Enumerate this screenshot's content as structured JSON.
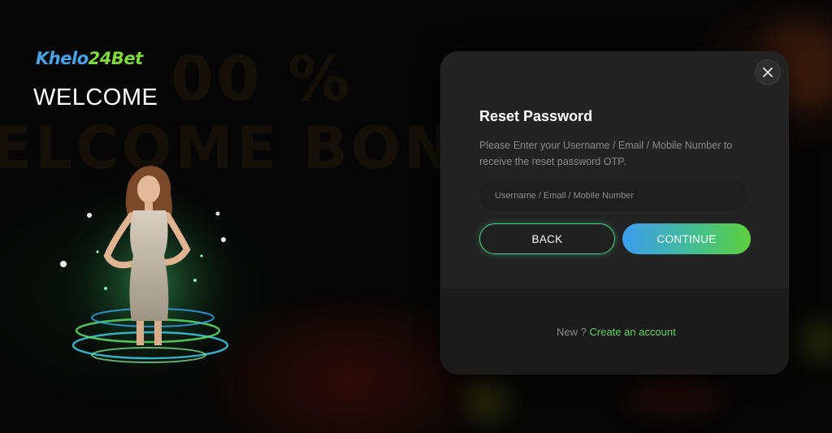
{
  "brand": {
    "logo_part1": "Khelo",
    "logo_part2": "24",
    "logo_part3": "Bet",
    "welcome": "WELCOME",
    "colors": {
      "blue": "#4aa3e8",
      "green": "#7fd73d"
    }
  },
  "background": {
    "promo_line1": "00 %",
    "promo_line2": "ELCOME BONU"
  },
  "modal": {
    "title": "Reset Password",
    "description": "Please Enter your Username / Email / Mobile Number to receive the reset password OTP.",
    "input_placeholder": "Username / Email / Mobile Number",
    "input_value": "",
    "back_label": "BACK",
    "continue_label": "CONTINUE",
    "footer_prefix": "New ?",
    "footer_link": "Create an account",
    "close_icon": "close-icon"
  },
  "colors": {
    "modal_bg": "#232323",
    "accent_green": "#44d48a",
    "continue_gradient_start": "#3c9df0",
    "continue_gradient_end": "#5fcf3e",
    "link_green": "#5fd35a"
  }
}
